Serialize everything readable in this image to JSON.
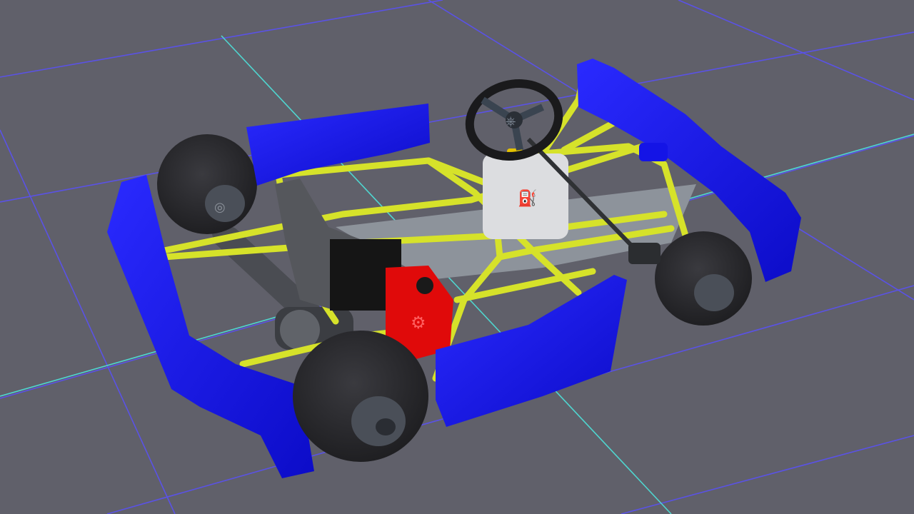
{
  "scene": {
    "background_color": "#60606a",
    "grid_color": "#5a52e6",
    "grid_axis_color": "#4fd6d0",
    "frame_color": "#d6e22a",
    "bodywork_color": "#1414e6",
    "tire_color": "#2c2c30",
    "wheel_hub_color": "#4a4f58",
    "engine_color": "#e00a0a",
    "air_box_color": "#151515",
    "fuel_tank_color": "#dcdde0",
    "seat_color": "#55575c",
    "floor_pan_color": "#8d939b",
    "icons": [
      "steering-wheel-icon",
      "fuel-tank-icon",
      "engine-icon",
      "wheel-icon"
    ]
  }
}
